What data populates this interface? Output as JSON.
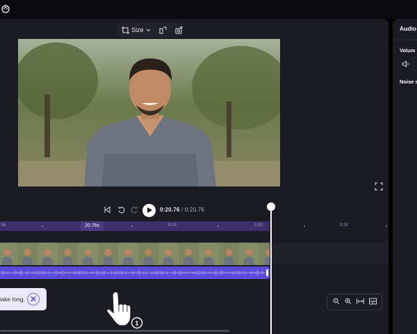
{
  "toolbar": {
    "size_label": "Size",
    "icons": [
      "crop-resize-icon",
      "chevron-down-icon",
      "flip-icon",
      "add-image-icon"
    ]
  },
  "playback": {
    "current_time": "0:20.76",
    "separator": "/",
    "total_time": "0:20.76"
  },
  "timeline": {
    "ruler_labels": {
      "start": ":05",
      "marker": "20.76s",
      "t15": "0:15",
      "t20": "0:20",
      "t25": "0:25"
    }
  },
  "toast": {
    "text": "take long."
  },
  "sidebar": {
    "heading": "Audio",
    "volume_label": "Volum",
    "noise_label": "Noise s"
  },
  "colors": {
    "accent": "#5b4bd8",
    "ruler_fill": "#3d2f6b",
    "panel": "#1b1b24",
    "background": "#000000",
    "toast_bg": "#ece9fb"
  },
  "cursor": {
    "badge": "1"
  }
}
